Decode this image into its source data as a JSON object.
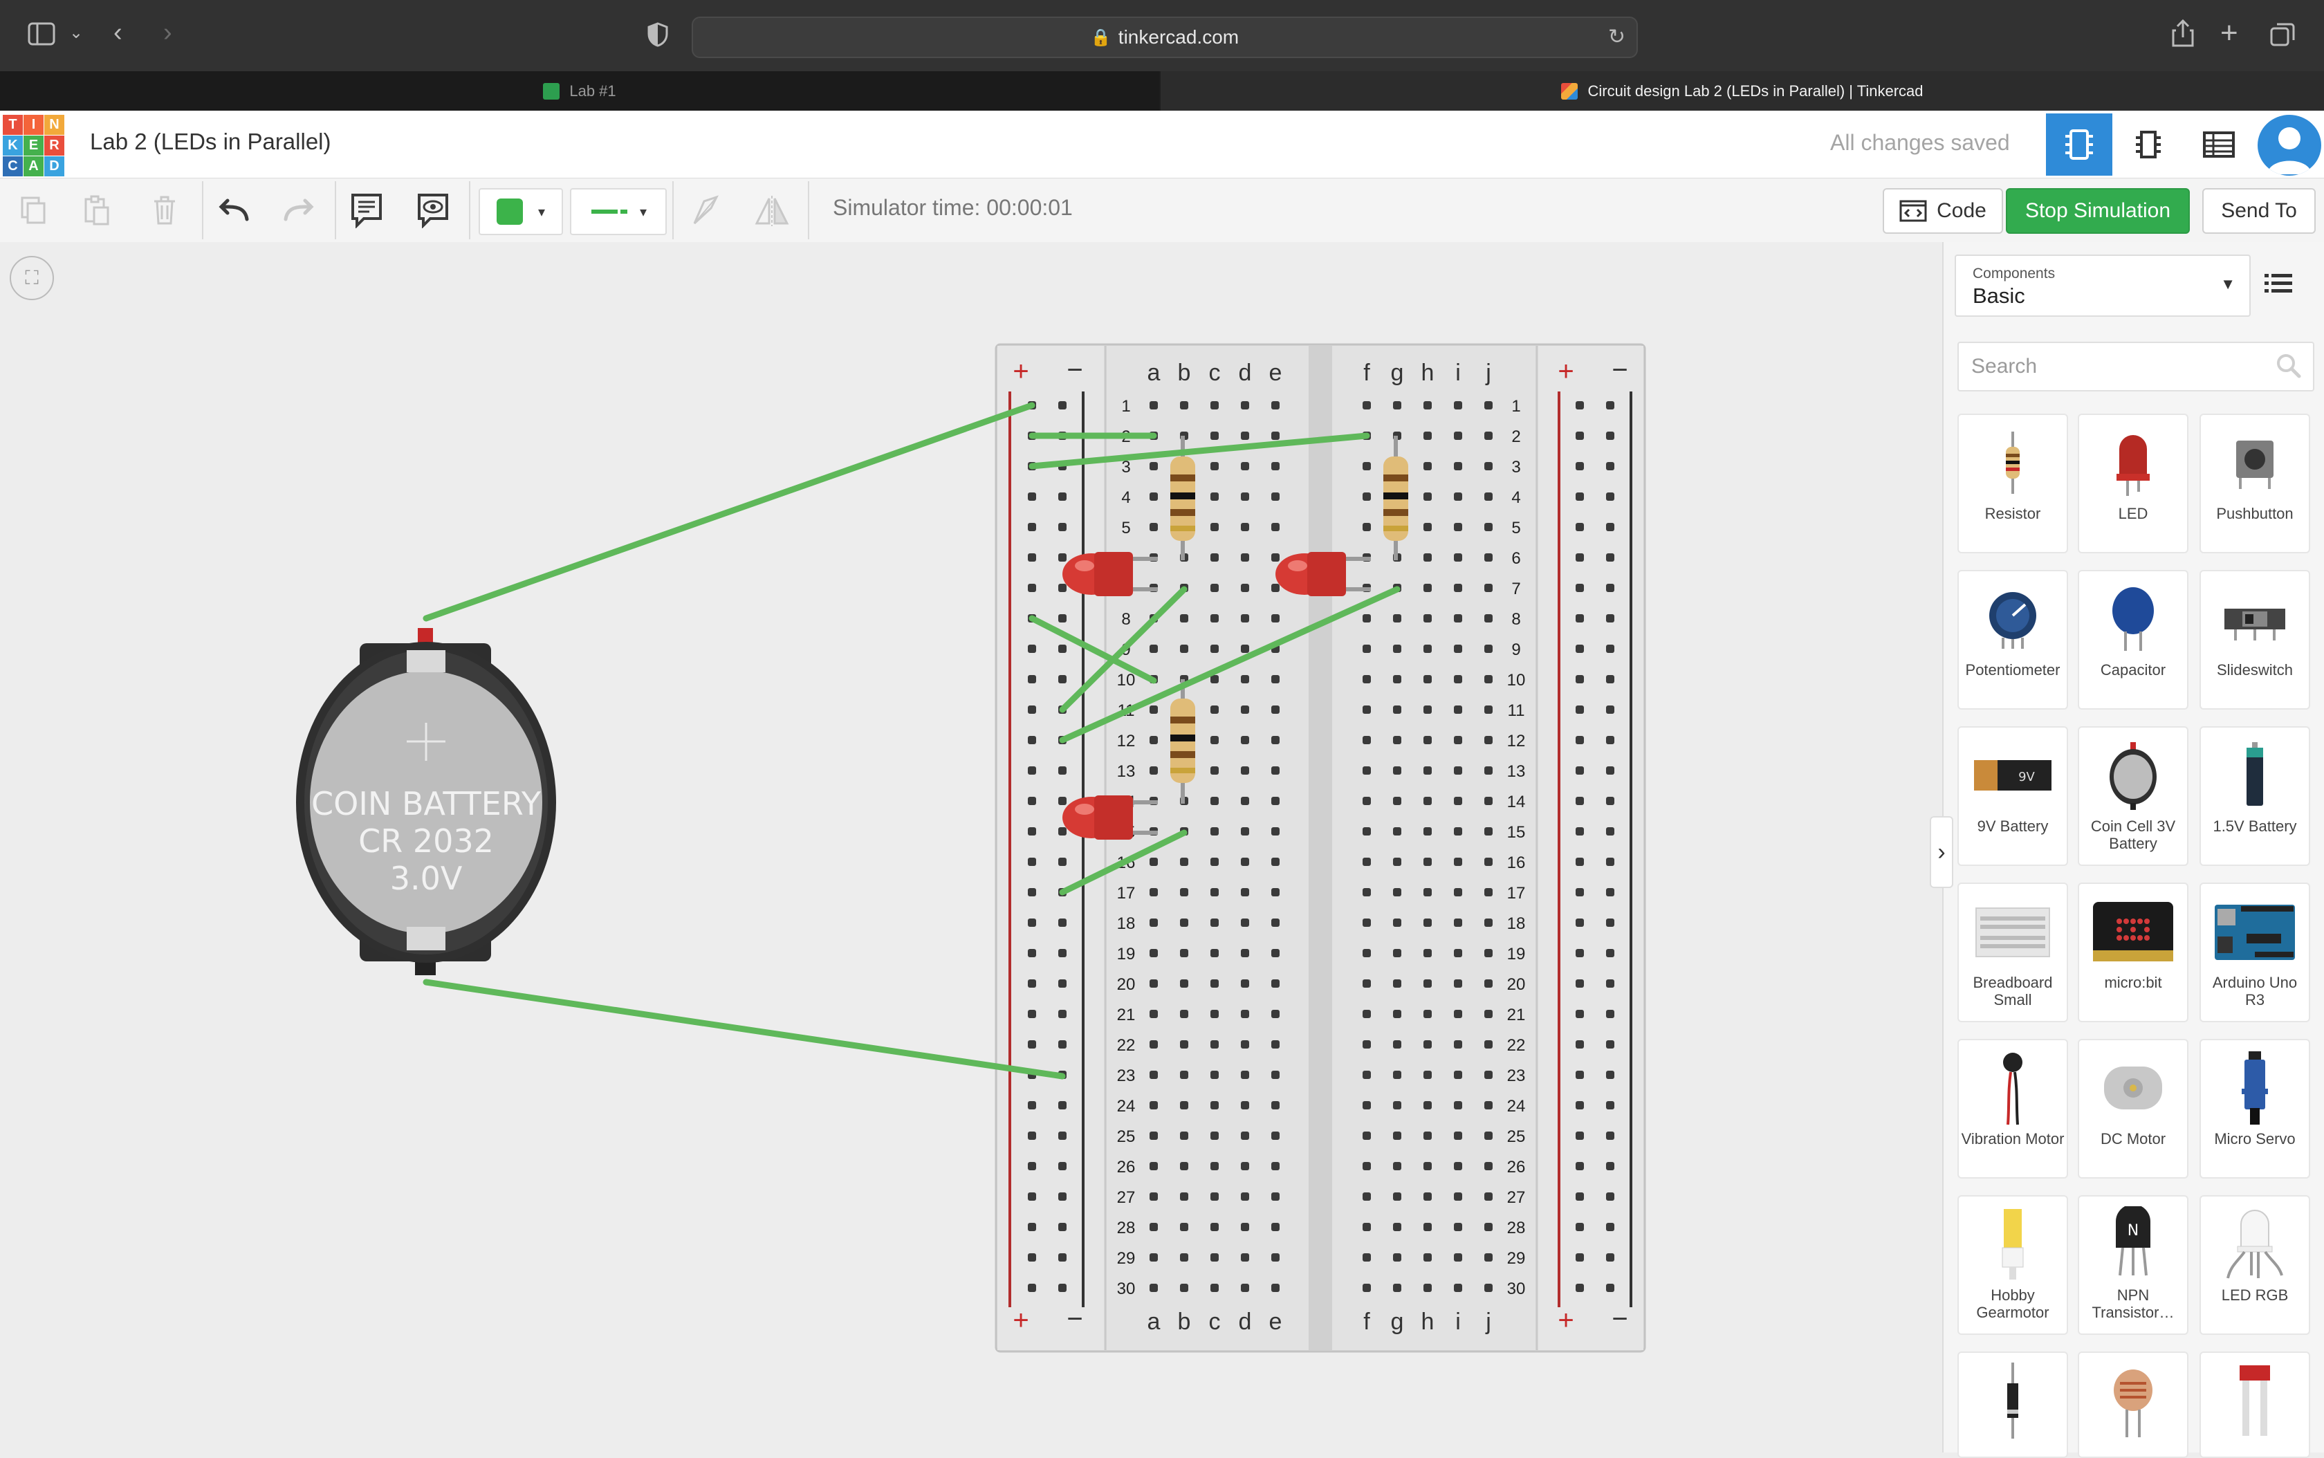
{
  "browser": {
    "url": "tinkercad.com",
    "tabs": [
      {
        "label": "Lab #1",
        "active": false
      },
      {
        "label": "Circuit design Lab 2 (LEDs in Parallel) | Tinkercad",
        "active": true
      }
    ]
  },
  "header": {
    "logo_letters": [
      "T",
      "I",
      "N",
      "K",
      "E",
      "R",
      "C",
      "A",
      "D"
    ],
    "project_title": "Lab 2 (LEDs in Parallel)",
    "save_status": "All changes saved"
  },
  "toolbar": {
    "simulator_time": "Simulator time: 00:00:01",
    "code_label": "Code",
    "stop_simulation_label": "Stop Simulation",
    "send_to_label": "Send To",
    "wire_color": "#3cb34a"
  },
  "canvas": {
    "battery": {
      "line1": "COIN BATTERY",
      "line2": "CR 2032",
      "line3": "3.0V"
    },
    "breadboard": {
      "left_columns": [
        "a",
        "b",
        "c",
        "d",
        "e"
      ],
      "right_columns": [
        "f",
        "g",
        "h",
        "i",
        "j"
      ],
      "rail_plus": "+",
      "rail_minus": "−",
      "rows": 30
    }
  },
  "panel": {
    "components_label": "Components",
    "components_value": "Basic",
    "search_placeholder": "Search",
    "components": [
      {
        "name": "Resistor",
        "icon": "resistor-icon"
      },
      {
        "name": "LED",
        "icon": "led-icon"
      },
      {
        "name": "Pushbutton",
        "icon": "pushbutton-icon"
      },
      {
        "name": "Potentiometer",
        "icon": "potentiometer-icon"
      },
      {
        "name": "Capacitor",
        "icon": "capacitor-icon"
      },
      {
        "name": "Slideswitch",
        "icon": "slideswitch-icon"
      },
      {
        "name": "9V Battery",
        "icon": "battery-9v-icon"
      },
      {
        "name": "Coin Cell 3V Battery",
        "icon": "coin-cell-icon"
      },
      {
        "name": "1.5V Battery",
        "icon": "battery-aa-icon"
      },
      {
        "name": "Breadboard Small",
        "icon": "breadboard-icon"
      },
      {
        "name": "micro:bit",
        "icon": "microbit-icon"
      },
      {
        "name": "Arduino Uno R3",
        "icon": "arduino-icon"
      },
      {
        "name": "Vibration Motor",
        "icon": "vibration-motor-icon"
      },
      {
        "name": "DC Motor",
        "icon": "dc-motor-icon"
      },
      {
        "name": "Micro Servo",
        "icon": "servo-icon"
      },
      {
        "name": "Hobby Gearmotor",
        "icon": "gearmotor-icon"
      },
      {
        "name": "NPN Transistor…",
        "icon": "transistor-icon"
      },
      {
        "name": "LED RGB",
        "icon": "led-rgb-icon"
      },
      {
        "name": "",
        "icon": "diode-icon"
      },
      {
        "name": "",
        "icon": "photoresistor-icon"
      },
      {
        "name": "",
        "icon": "sensor-icon"
      }
    ]
  }
}
